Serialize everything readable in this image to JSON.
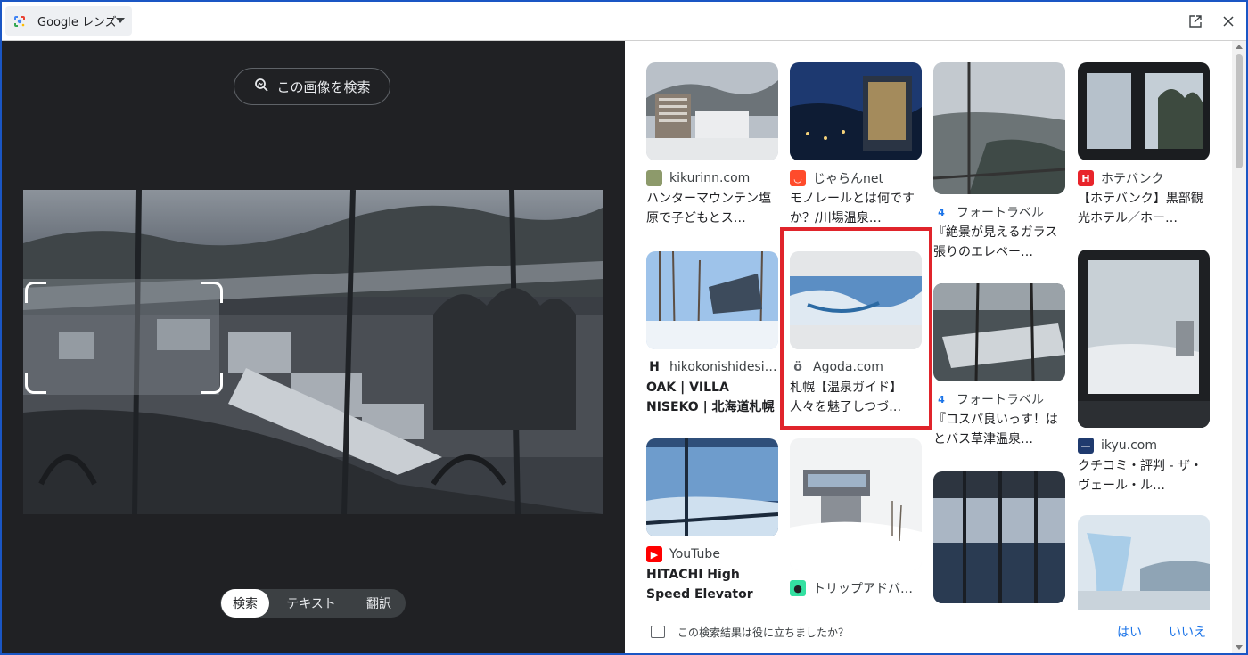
{
  "window": {
    "app_title": "Google レンズ",
    "open_new_tab_icon": "open-in-new-icon",
    "close_icon": "close-icon"
  },
  "left_panel": {
    "search_image_label": "この画像を検索",
    "modes": [
      "検索",
      "テキスト",
      "翻訳"
    ],
    "active_mode": "検索"
  },
  "results": [
    {
      "source": "kikurinn.com",
      "title": "ハンターマウンテン塩原で子どもとス…",
      "favicon": "photo-favicon",
      "favicon_color": "#8d9a6b"
    },
    {
      "source": "じゃらんnet",
      "title": "モノレールとは何ですか？/川場温泉…",
      "favicon": "jalan-favicon",
      "favicon_color": "#ff4b2b"
    },
    {
      "source": "フォートラベル",
      "title": "『絶景が見えるガラス張りのエレベー…",
      "favicon": "4travel-favicon",
      "favicon_color": "#1a73e8"
    },
    {
      "source": "ホテバンク",
      "title": "【ホテバンク】黒部観光ホテル／ホー…",
      "favicon": "hotebank-favicon",
      "favicon_color": "#e8242b"
    },
    {
      "source": "hikokonishidesi…",
      "title": "OAK | VILLA NISEKO | 北海道札幌の建築…",
      "favicon": "h-favicon",
      "favicon_color": "#202124"
    },
    {
      "source": "Agoda.com",
      "title": "札幌【温泉ガイド】人々を魅了しつづ…",
      "favicon": "agoda-favicon",
      "favicon_color": "#5f6368"
    },
    {
      "source": "フォートラベル",
      "title": "『コスパ良いっす！はとバス草津温泉…",
      "favicon": "4travel-favicon",
      "favicon_color": "#1a73e8"
    },
    {
      "source": "ikyu.com",
      "title": "クチコミ・評判 - ザ・ヴェール・ル…",
      "favicon": "ikyu-favicon",
      "favicon_color": "#1f3a6e"
    },
    {
      "source": "YouTube",
      "title": "HITACHI High Speed Elevator at…",
      "favicon": "youtube-favicon",
      "favicon_color": "#ff0000"
    },
    {
      "source": "トリップアドバ…",
      "title": "",
      "favicon": "tripadvisor-favicon",
      "favicon_color": "#34e0a1"
    }
  ],
  "highlight_color": "#e0242b",
  "feedback": {
    "question": "この検索結果は役に立ちましたか？",
    "yes": "はい",
    "no": "いいえ"
  }
}
